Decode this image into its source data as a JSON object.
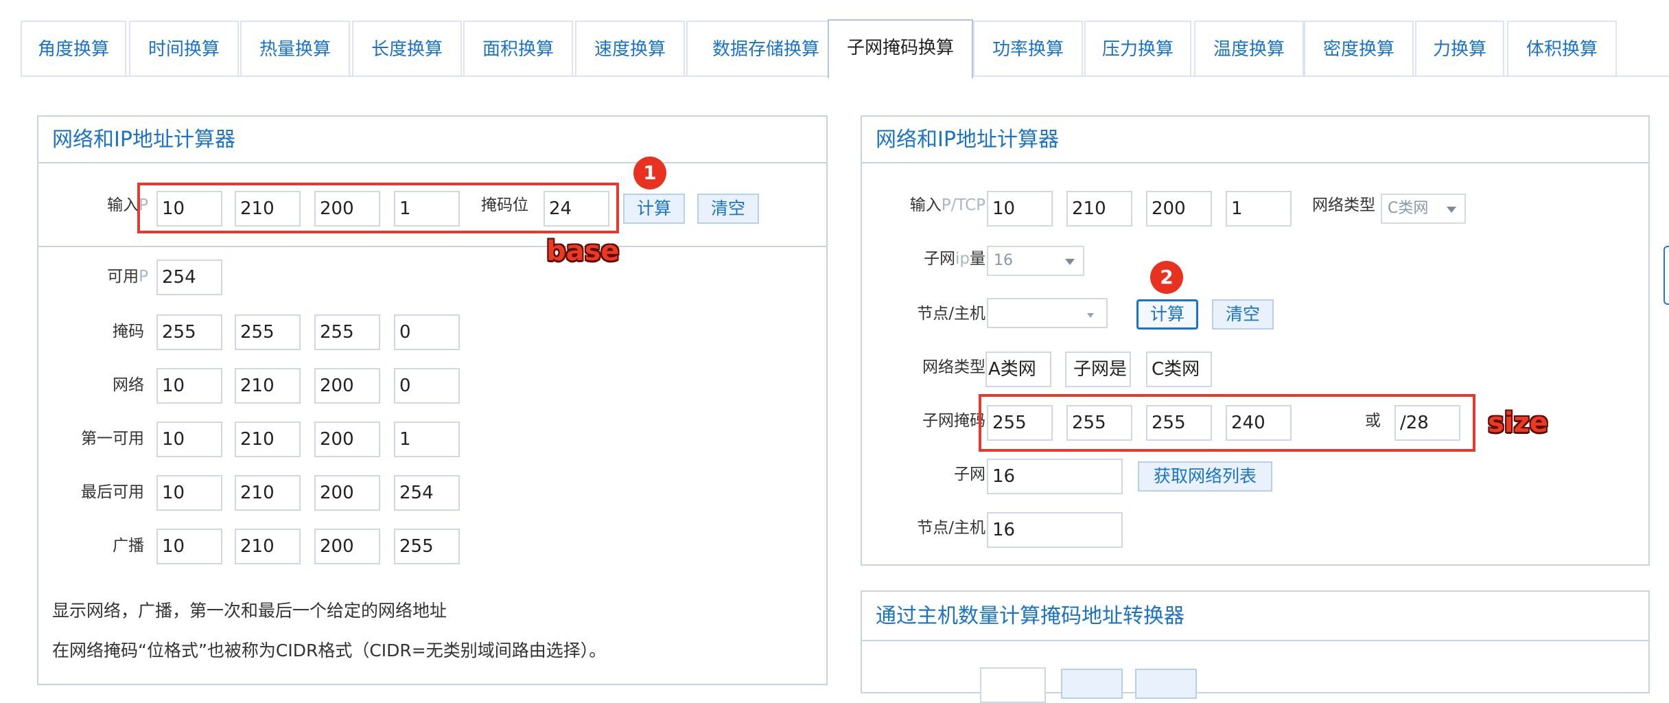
{
  "tabs": [
    {
      "label": "角度换算",
      "active": false
    },
    {
      "label": "时间换算",
      "active": false
    },
    {
      "label": "热量换算",
      "active": false
    },
    {
      "label": "长度换算",
      "active": false
    },
    {
      "label": "面积换算",
      "active": false
    },
    {
      "label": "速度换算",
      "active": false
    },
    {
      "label": "数据存储换算",
      "active": false
    },
    {
      "label": "子网掩码换算",
      "active": true
    },
    {
      "label": "功率换算",
      "active": false
    },
    {
      "label": "压力换算",
      "active": false
    },
    {
      "label": "温度换算",
      "active": false
    },
    {
      "label": "密度换算",
      "active": false
    },
    {
      "label": "力换算",
      "active": false
    },
    {
      "label": "体积换算",
      "active": false
    }
  ],
  "left_panel": {
    "title": "网络和IP地址计算器",
    "input_label_main": "输入",
    "input_label_faint": "P",
    "ip": [
      "10",
      "210",
      "200",
      "1"
    ],
    "mask_bits_label": "掩码位",
    "mask_bits": "24",
    "calc_button": "计算",
    "clear_button": "清空",
    "available_ip_label_main": "可用",
    "available_ip_label_faint": "P",
    "available_ip": "254",
    "rows": [
      {
        "label": "掩码",
        "values": [
          "255",
          "255",
          "255",
          "0"
        ]
      },
      {
        "label": "网络",
        "values": [
          "10",
          "210",
          "200",
          "0"
        ]
      },
      {
        "label": "第一可用",
        "values": [
          "10",
          "210",
          "200",
          "1"
        ]
      },
      {
        "label": "最后可用",
        "values": [
          "10",
          "210",
          "200",
          "254"
        ]
      },
      {
        "label": "广播",
        "values": [
          "10",
          "210",
          "200",
          "255"
        ]
      }
    ],
    "note1": "显示网络，广播，第一次和最后一个给定的网络地址",
    "note2": "在网络掩码“位格式”也被称为CIDR格式（CIDR=无类别域间路由选择）。"
  },
  "right_panel": {
    "title": "网络和IP地址计算器",
    "input_label_main": "输入",
    "input_label_faint": "P/TCP",
    "ip": [
      "10",
      "210",
      "200",
      "1"
    ],
    "network_type_label": "网络类型",
    "network_type_select": "C类网",
    "subnet_ip_count_label_main": "子网",
    "subnet_ip_count_label_faint": "ip",
    "subnet_ip_count_label_tail": "量",
    "subnet_ip_count_select": "16",
    "node_host_label": "节点/主机",
    "node_host_select": "",
    "calc_button": "计算",
    "clear_button": "清空",
    "network_type_row_label": "网络类型",
    "network_type_values": [
      "A类网",
      "子网是",
      "C类网"
    ],
    "subnet_mask_label": "子网掩码",
    "subnet_mask": [
      "255",
      "255",
      "255",
      "240"
    ],
    "or_label": "或",
    "cidr": "/28",
    "subnet_label": "子网",
    "subnet_value": "16",
    "get_list_button": "获取网络列表",
    "node_host_value_label": "节点/主机",
    "node_host_value": "16"
  },
  "bottom_right_panel": {
    "title": "通过主机数量计算掩码地址转换器"
  },
  "annotations": {
    "badge1": "1",
    "badge2": "2",
    "base_label": "base",
    "size_label": "size",
    "accent_color": "#e63a2e",
    "link_color": "#1a73c8"
  }
}
